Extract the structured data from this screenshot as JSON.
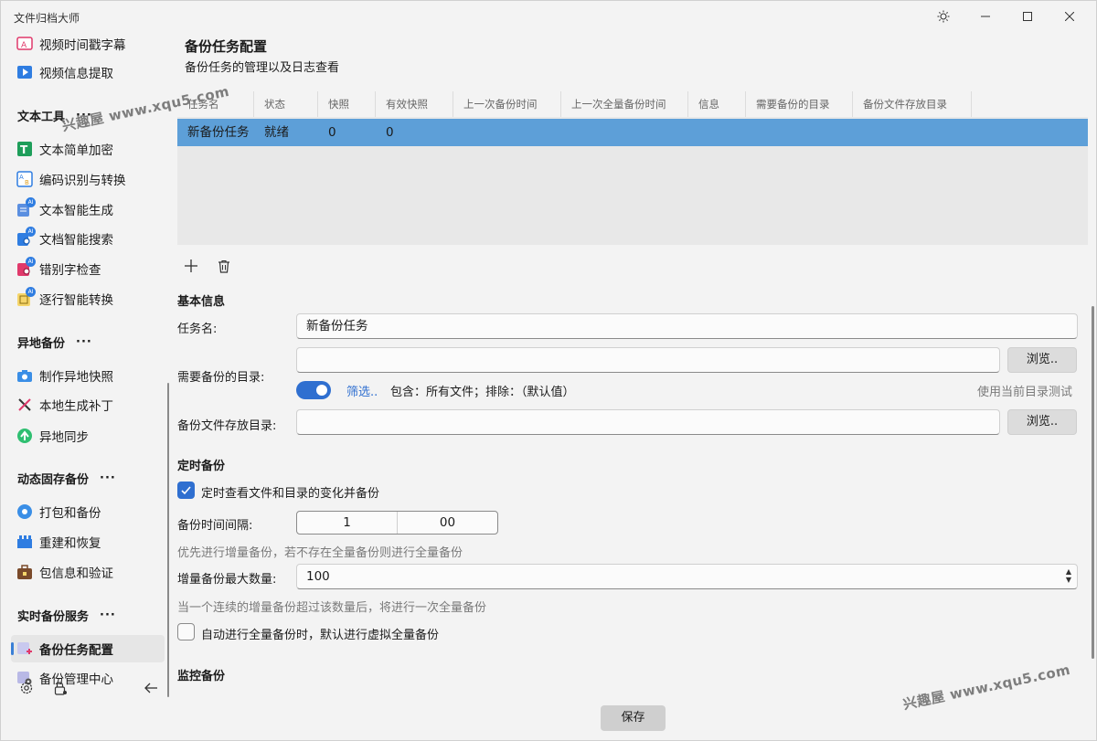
{
  "window": {
    "title": "文件归档大师"
  },
  "sidebar": {
    "top_items": [
      {
        "label": "视频时间戳字幕",
        "icon": "video-subtitle-icon"
      },
      {
        "label": "视频信息提取",
        "icon": "video-info-icon"
      }
    ],
    "sections": [
      {
        "title": "文本工具",
        "more": "···",
        "items": [
          {
            "label": "文本简单加密",
            "icon": "text-encrypt-icon"
          },
          {
            "label": "编码识别与转换",
            "icon": "encoding-convert-icon"
          },
          {
            "label": "文本智能生成",
            "icon": "ai-text-generate-icon",
            "badge": "AI"
          },
          {
            "label": "文档智能搜索",
            "icon": "ai-doc-search-icon",
            "badge": "AI"
          },
          {
            "label": "错别字检查",
            "icon": "ai-typo-check-icon",
            "badge": "AI"
          },
          {
            "label": "逐行智能转换",
            "icon": "ai-line-convert-icon",
            "badge": "AI"
          }
        ]
      },
      {
        "title": "异地备份",
        "more": "···",
        "items": [
          {
            "label": "制作异地快照",
            "icon": "camera-snapshot-icon"
          },
          {
            "label": "本地生成补丁",
            "icon": "patch-tools-icon"
          },
          {
            "label": "异地同步",
            "icon": "sync-upload-icon"
          }
        ]
      },
      {
        "title": "动态固存备份",
        "more": "···",
        "items": [
          {
            "label": "打包和备份",
            "icon": "pack-backup-icon"
          },
          {
            "label": "重建和恢复",
            "icon": "rebuild-restore-icon"
          },
          {
            "label": "包信息和验证",
            "icon": "package-verify-icon"
          }
        ]
      },
      {
        "title": "实时备份服务",
        "more": "···",
        "items": [
          {
            "label": "备份任务配置",
            "icon": "backup-task-config-icon",
            "selected": true
          },
          {
            "label": "备份管理中心",
            "icon": "backup-manage-icon"
          }
        ]
      }
    ]
  },
  "main": {
    "title": "备份任务配置",
    "subtitle": "备份任务的管理以及日志查看",
    "table": {
      "columns": [
        "任务名",
        "状态",
        "快照",
        "有效快照",
        "上一次备份时间",
        "上一次全量备份时间",
        "信息",
        "需要备份的目录",
        "备份文件存放目录"
      ],
      "rows": [
        [
          "新备份任务",
          "就绪",
          "0",
          "0",
          "",
          "",
          "",
          "",
          ""
        ]
      ]
    },
    "basic": {
      "section_title": "基本信息",
      "task_name_label": "任务名:",
      "task_name_value": "新备份任务",
      "source_dir_label": "需要备份的目录:",
      "source_dir_value": "",
      "browse_label": "浏览..",
      "filter_link": "筛选..",
      "filter_summary": "包含：所有文件；排除：（默认值）",
      "test_link": "使用当前目录测试",
      "dest_dir_label": "备份文件存放目录:",
      "dest_dir_value": ""
    },
    "schedule": {
      "section_title": "定时备份",
      "watch_label": "定时查看文件和目录的变化并备份",
      "interval_label": "备份时间间隔:",
      "interval_hours": "1",
      "interval_minutes": "00",
      "hint1": "优先进行增量备份，若不存在全量备份则进行全量备份",
      "max_incr_label": "增量备份最大数量:",
      "max_incr_value": "100",
      "hint2": "当一个连续的增量备份超过该数量后，将进行一次全量备份",
      "virtual_label": "自动进行全量备份时，默认进行虚拟全量备份"
    },
    "monitor": {
      "section_title": "监控备份"
    },
    "save_label": "保存"
  },
  "watermark": "兴趣屋 www.xqu5.com",
  "colors": {
    "accent": "#2f6fd0",
    "selected_row": "#5d9fd8"
  }
}
